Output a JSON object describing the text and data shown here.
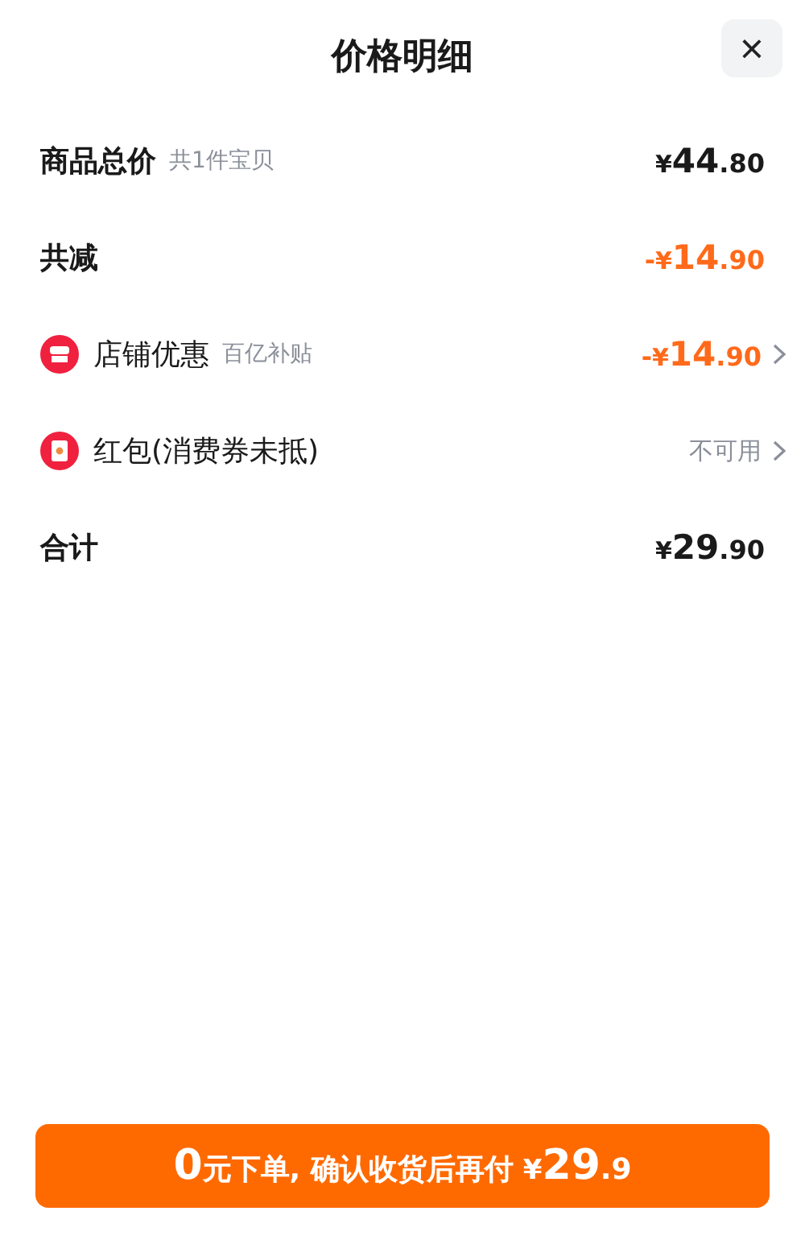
{
  "title": "价格明细",
  "close": {
    "label": "×"
  },
  "rows": [
    {
      "kind": "plain",
      "label": "商品总价",
      "note": "共1件宝贝",
      "highlight": false,
      "price": {
        "currency": "¥",
        "integer": "44",
        "decimal": ".80"
      },
      "arrow": false
    },
    {
      "kind": "plain",
      "label": "共减",
      "highlight": true,
      "price": {
        "sign": "-",
        "currency": "¥",
        "integer": "14",
        "decimal": ".90"
      },
      "arrow": false
    },
    {
      "kind": "shop",
      "label": "店铺优惠",
      "note": "百亿补贴",
      "highlight": true,
      "price": {
        "sign": "-",
        "currency": "¥",
        "integer": "14",
        "decimal": ".90"
      },
      "arrow": true
    },
    {
      "kind": "redpacket",
      "label": "红包(消费券未抵)",
      "value": "不可用",
      "arrow": true
    },
    {
      "kind": "plain",
      "label": "合计",
      "highlight": false,
      "price": {
        "currency": "¥",
        "integer": "29",
        "decimal": ".90"
      },
      "arrow": false
    }
  ],
  "button": {
    "lead": "0",
    "text": "元下单, 确认收货后再付",
    "currency": "¥",
    "integer": "29",
    "decimal": ".9"
  }
}
